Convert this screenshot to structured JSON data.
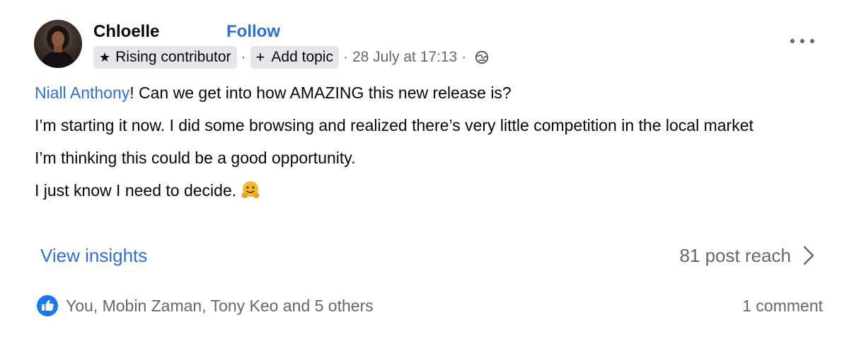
{
  "author": {
    "name": "Chloelle",
    "follow_label": "Follow",
    "badge_label": "Rising contributor",
    "badge_icon": "star-icon"
  },
  "meta": {
    "add_topic_label": "Add topic",
    "add_topic_icon": "plus-icon",
    "timestamp": "28 July at 17:13",
    "audience_icon": "globe-icon"
  },
  "post": {
    "mention": "Niall Anthony",
    "line1_rest": "! Can we get into how AMAZING this new release is?",
    "line2": "I’m starting it now. I did some browsing and realized there’s very little competition in the local market",
    "line3": "I’m thinking this could be a good opportunity.",
    "line4": "I just know I need to decide.",
    "line4_emoji": "hugging-face-emoji"
  },
  "insights": {
    "link_label": "View insights",
    "reach_label": "81 post reach"
  },
  "engagement": {
    "reactions_text": "You, Mobin Zaman, Tony Keo and 5 others",
    "comments_text": "1 comment",
    "reaction_icon": "like-icon"
  },
  "colors": {
    "link_blue": "#2d6fdc",
    "secondary_text": "#65676b",
    "chip_background": "#e4e6eb",
    "like_blue": "#1877f2"
  }
}
